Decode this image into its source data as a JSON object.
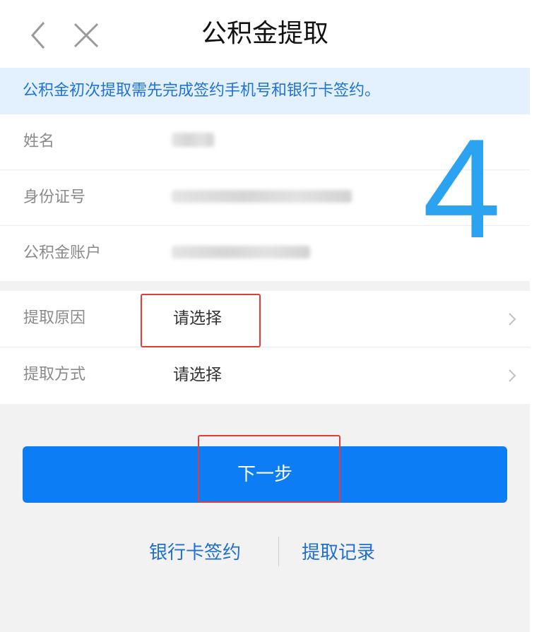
{
  "header": {
    "title": "公积金提取",
    "back_icon": "chevron-left-icon",
    "close_icon": "close-icon"
  },
  "notice": {
    "text": "公积金初次提取需先完成签约手机号和银行卡签约。"
  },
  "info": {
    "name_label": "姓名",
    "id_label": "身份证号",
    "account_label": "公积金账户"
  },
  "overlay_number": "4",
  "selections": {
    "reason_label": "提取原因",
    "reason_value": "请选择",
    "method_label": "提取方式",
    "method_value": "请选择"
  },
  "next_button": {
    "label": "下一步"
  },
  "links": {
    "bank_card_sign": "银行卡签约",
    "withdraw_record": "提取记录"
  },
  "colors": {
    "accent": "#0c7df4",
    "notice_bg": "#e3f0fd",
    "highlight": "#e23b3b",
    "overlay_number": "#2ba3f0"
  }
}
